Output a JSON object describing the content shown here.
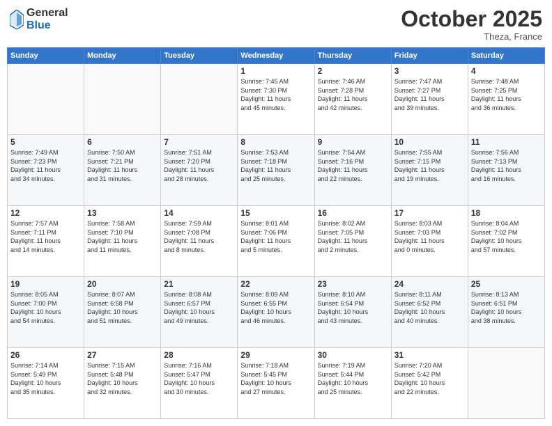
{
  "header": {
    "logo_general": "General",
    "logo_blue": "Blue",
    "month_title": "October 2025",
    "location": "Theza, France"
  },
  "weekdays": [
    "Sunday",
    "Monday",
    "Tuesday",
    "Wednesday",
    "Thursday",
    "Friday",
    "Saturday"
  ],
  "weeks": [
    [
      {
        "day": "",
        "info": ""
      },
      {
        "day": "",
        "info": ""
      },
      {
        "day": "",
        "info": ""
      },
      {
        "day": "1",
        "info": "Sunrise: 7:45 AM\nSunset: 7:30 PM\nDaylight: 11 hours\nand 45 minutes."
      },
      {
        "day": "2",
        "info": "Sunrise: 7:46 AM\nSunset: 7:28 PM\nDaylight: 11 hours\nand 42 minutes."
      },
      {
        "day": "3",
        "info": "Sunrise: 7:47 AM\nSunset: 7:27 PM\nDaylight: 11 hours\nand 39 minutes."
      },
      {
        "day": "4",
        "info": "Sunrise: 7:48 AM\nSunset: 7:25 PM\nDaylight: 11 hours\nand 36 minutes."
      }
    ],
    [
      {
        "day": "5",
        "info": "Sunrise: 7:49 AM\nSunset: 7:23 PM\nDaylight: 11 hours\nand 34 minutes."
      },
      {
        "day": "6",
        "info": "Sunrise: 7:50 AM\nSunset: 7:21 PM\nDaylight: 11 hours\nand 31 minutes."
      },
      {
        "day": "7",
        "info": "Sunrise: 7:51 AM\nSunset: 7:20 PM\nDaylight: 11 hours\nand 28 minutes."
      },
      {
        "day": "8",
        "info": "Sunrise: 7:53 AM\nSunset: 7:18 PM\nDaylight: 11 hours\nand 25 minutes."
      },
      {
        "day": "9",
        "info": "Sunrise: 7:54 AM\nSunset: 7:16 PM\nDaylight: 11 hours\nand 22 minutes."
      },
      {
        "day": "10",
        "info": "Sunrise: 7:55 AM\nSunset: 7:15 PM\nDaylight: 11 hours\nand 19 minutes."
      },
      {
        "day": "11",
        "info": "Sunrise: 7:56 AM\nSunset: 7:13 PM\nDaylight: 11 hours\nand 16 minutes."
      }
    ],
    [
      {
        "day": "12",
        "info": "Sunrise: 7:57 AM\nSunset: 7:11 PM\nDaylight: 11 hours\nand 14 minutes."
      },
      {
        "day": "13",
        "info": "Sunrise: 7:58 AM\nSunset: 7:10 PM\nDaylight: 11 hours\nand 11 minutes."
      },
      {
        "day": "14",
        "info": "Sunrise: 7:59 AM\nSunset: 7:08 PM\nDaylight: 11 hours\nand 8 minutes."
      },
      {
        "day": "15",
        "info": "Sunrise: 8:01 AM\nSunset: 7:06 PM\nDaylight: 11 hours\nand 5 minutes."
      },
      {
        "day": "16",
        "info": "Sunrise: 8:02 AM\nSunset: 7:05 PM\nDaylight: 11 hours\nand 2 minutes."
      },
      {
        "day": "17",
        "info": "Sunrise: 8:03 AM\nSunset: 7:03 PM\nDaylight: 11 hours\nand 0 minutes."
      },
      {
        "day": "18",
        "info": "Sunrise: 8:04 AM\nSunset: 7:02 PM\nDaylight: 10 hours\nand 57 minutes."
      }
    ],
    [
      {
        "day": "19",
        "info": "Sunrise: 8:05 AM\nSunset: 7:00 PM\nDaylight: 10 hours\nand 54 minutes."
      },
      {
        "day": "20",
        "info": "Sunrise: 8:07 AM\nSunset: 6:58 PM\nDaylight: 10 hours\nand 51 minutes."
      },
      {
        "day": "21",
        "info": "Sunrise: 8:08 AM\nSunset: 6:57 PM\nDaylight: 10 hours\nand 49 minutes."
      },
      {
        "day": "22",
        "info": "Sunrise: 8:09 AM\nSunset: 6:55 PM\nDaylight: 10 hours\nand 46 minutes."
      },
      {
        "day": "23",
        "info": "Sunrise: 8:10 AM\nSunset: 6:54 PM\nDaylight: 10 hours\nand 43 minutes."
      },
      {
        "day": "24",
        "info": "Sunrise: 8:11 AM\nSunset: 6:52 PM\nDaylight: 10 hours\nand 40 minutes."
      },
      {
        "day": "25",
        "info": "Sunrise: 8:13 AM\nSunset: 6:51 PM\nDaylight: 10 hours\nand 38 minutes."
      }
    ],
    [
      {
        "day": "26",
        "info": "Sunrise: 7:14 AM\nSunset: 5:49 PM\nDaylight: 10 hours\nand 35 minutes."
      },
      {
        "day": "27",
        "info": "Sunrise: 7:15 AM\nSunset: 5:48 PM\nDaylight: 10 hours\nand 32 minutes."
      },
      {
        "day": "28",
        "info": "Sunrise: 7:16 AM\nSunset: 5:47 PM\nDaylight: 10 hours\nand 30 minutes."
      },
      {
        "day": "29",
        "info": "Sunrise: 7:18 AM\nSunset: 5:45 PM\nDaylight: 10 hours\nand 27 minutes."
      },
      {
        "day": "30",
        "info": "Sunrise: 7:19 AM\nSunset: 5:44 PM\nDaylight: 10 hours\nand 25 minutes."
      },
      {
        "day": "31",
        "info": "Sunrise: 7:20 AM\nSunset: 5:42 PM\nDaylight: 10 hours\nand 22 minutes."
      },
      {
        "day": "",
        "info": ""
      }
    ]
  ]
}
